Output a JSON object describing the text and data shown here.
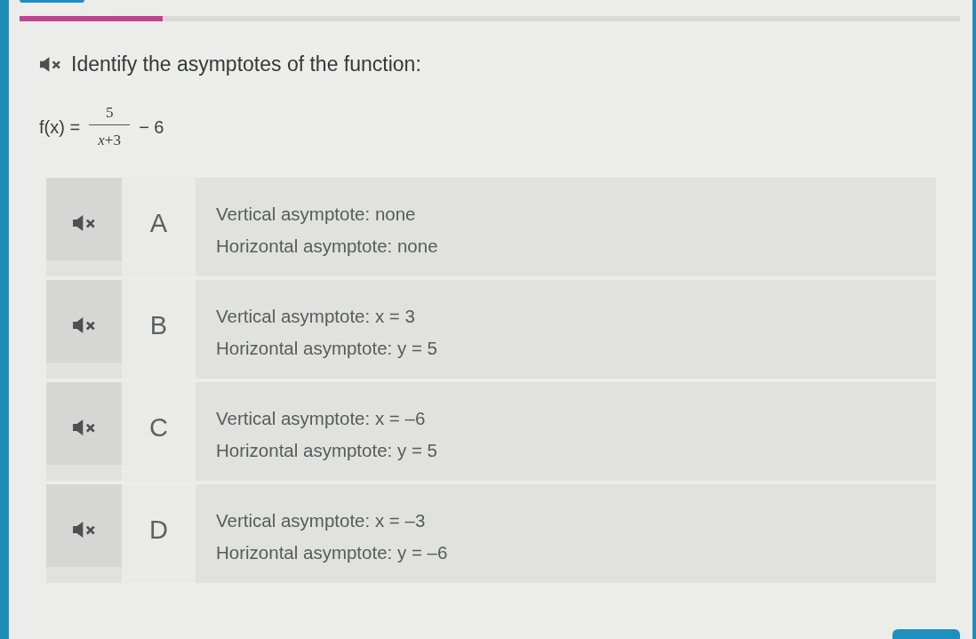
{
  "progress": {
    "level": 0.152
  },
  "question": {
    "prompt": "Identify the asymptotes of the function:",
    "formula": {
      "lhs": "f(x) =",
      "numerator": "5",
      "denominator": "*x*+3",
      "tail": "− 6"
    }
  },
  "options": [
    {
      "letter": "A",
      "lines": [
        "Vertical asymptote: none",
        "Horizontal asymptote: none"
      ],
      "selected": false
    },
    {
      "letter": "B",
      "lines": [
        "Vertical asymptote: x = 3",
        "Horizontal asymptote: y = 5"
      ],
      "selected": false
    },
    {
      "letter": "C",
      "lines": [
        "Vertical asymptote: x = –6",
        "Horizontal asymptote: y = 5"
      ],
      "selected": false
    },
    {
      "letter": "D",
      "lines": [
        "Vertical asymptote: x = –3",
        "Horizontal asymptote: y = –6"
      ],
      "selected": false
    }
  ]
}
